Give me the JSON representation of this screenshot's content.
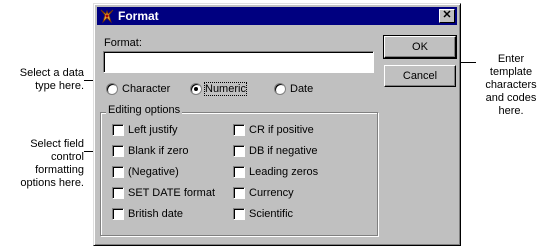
{
  "callouts": {
    "data_type": "Select a data type here.",
    "field_control": "Select field control formatting options here.",
    "template": "Enter template characters and codes here."
  },
  "window": {
    "title": "Format",
    "close_label": "✕"
  },
  "format_field": {
    "label": "Format:",
    "value": ""
  },
  "buttons": {
    "ok": "OK",
    "cancel": "Cancel"
  },
  "data_type": {
    "selected": "Numeric",
    "options": [
      {
        "label": "Character",
        "selected": false
      },
      {
        "label": "Numeric",
        "selected": true
      },
      {
        "label": "Date",
        "selected": false
      }
    ]
  },
  "editing_options": {
    "title": "Editing options",
    "left_column": [
      {
        "label": "Left justify",
        "checked": false
      },
      {
        "label": "Blank if zero",
        "checked": false
      },
      {
        "label": "(Negative)",
        "checked": false
      },
      {
        "label": "SET DATE format",
        "checked": false
      },
      {
        "label": "British date",
        "checked": false
      }
    ],
    "right_column": [
      {
        "label": "CR if positive",
        "checked": false
      },
      {
        "label": "DB if negative",
        "checked": false
      },
      {
        "label": "Leading zeros",
        "checked": false
      },
      {
        "label": "Currency",
        "checked": false
      },
      {
        "label": "Scientific",
        "checked": false
      }
    ]
  },
  "colors": {
    "titlebar": "#000080",
    "dialog_face": "#c0c0c0"
  }
}
